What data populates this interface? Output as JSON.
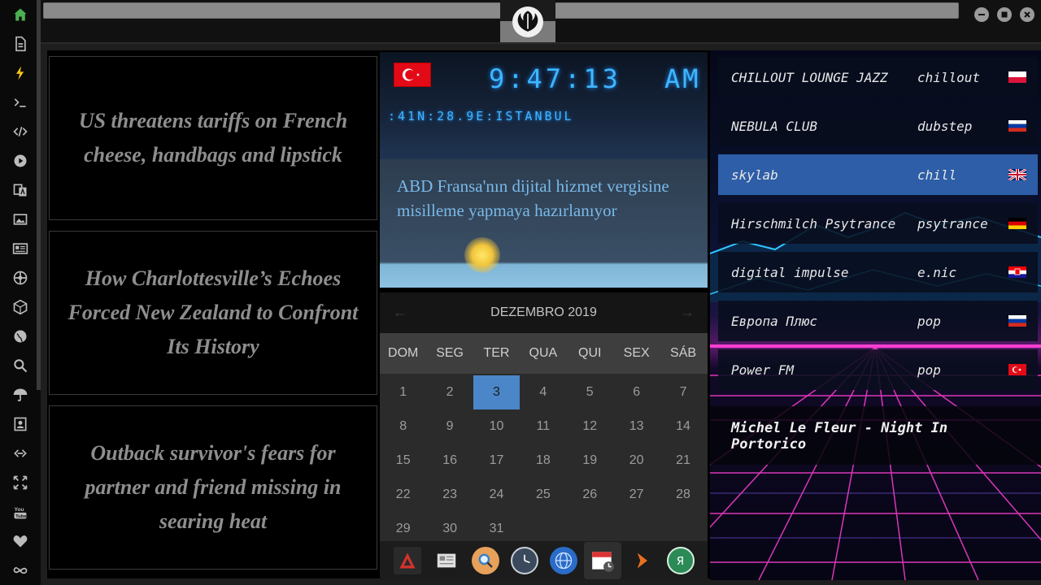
{
  "sidebar": {
    "items": [
      {
        "name": "home-icon"
      },
      {
        "name": "document-icon"
      },
      {
        "name": "lightning-icon"
      },
      {
        "name": "terminal-icon"
      },
      {
        "name": "code-icon"
      },
      {
        "name": "play-icon"
      },
      {
        "name": "translate-icon"
      },
      {
        "name": "image-icon"
      },
      {
        "name": "news-icon"
      },
      {
        "name": "aperture-icon"
      },
      {
        "name": "hexagon-icon"
      },
      {
        "name": "globe-icon"
      },
      {
        "name": "search-icon"
      },
      {
        "name": "umbrella-icon"
      },
      {
        "name": "contacts-icon"
      },
      {
        "name": "link-icon"
      },
      {
        "name": "expand-icon"
      },
      {
        "name": "youtube-icon"
      },
      {
        "name": "heart-icon"
      },
      {
        "name": "infinity-icon"
      }
    ],
    "active_color": "#4caf50"
  },
  "news": [
    "US threatens tariffs on French cheese, handbags and lipstick",
    "How Charlottesville’s Echoes Forced New Zealand to Confront Its History",
    "Outback survivor's fears for partner and friend missing in searing heat"
  ],
  "clock": {
    "time": "9:47:13",
    "ampm": "AM",
    "location": ":41N:28.9E:ISTANBUL",
    "flag": "turkey-flag"
  },
  "translated_news": "ABD Fransa'nın dijital hizmet vergisine misilleme yapmaya hazırlanıyor",
  "calendar": {
    "month": "DEZEMBRO 2019",
    "prev": "←",
    "next": "→",
    "weekdays": [
      "DOM",
      "SEG",
      "TER",
      "QUA",
      "QUI",
      "SEX",
      "SÁB"
    ],
    "weeks": [
      [
        "1",
        "2",
        "3",
        "4",
        "5",
        "6",
        "7"
      ],
      [
        "8",
        "9",
        "10",
        "11",
        "12",
        "13",
        "14"
      ],
      [
        "15",
        "16",
        "17",
        "18",
        "19",
        "20",
        "21"
      ],
      [
        "22",
        "23",
        "24",
        "25",
        "26",
        "27",
        "28"
      ],
      [
        "29",
        "30",
        "31",
        "",
        "",
        "",
        ""
      ]
    ],
    "today": "3"
  },
  "dock": [
    {
      "name": "app-red-icon"
    },
    {
      "name": "news-reader-icon"
    },
    {
      "name": "search-app-icon"
    },
    {
      "name": "clock-app-icon"
    },
    {
      "name": "browser-globe-icon"
    },
    {
      "name": "calendar-app-icon"
    },
    {
      "name": "media-play-icon"
    },
    {
      "name": "yandex-icon"
    }
  ],
  "radio": {
    "stations": [
      {
        "name": "CHILLOUT LOUNGE JAZZ",
        "genre": "chillout",
        "flag": "poland-flag"
      },
      {
        "name": "NEBULA CLUB",
        "genre": "dubstep",
        "flag": "russia-flag"
      },
      {
        "name": "skylab",
        "genre": "chill",
        "flag": "uk-flag"
      },
      {
        "name": "Hirschmilch Psytrance",
        "genre": "psytrance",
        "flag": "germany-flag"
      },
      {
        "name": "digital impulse",
        "genre": "e.nic",
        "flag": "croatia-flag"
      },
      {
        "name": "Европа Плюс",
        "genre": "pop",
        "flag": "russia-flag"
      },
      {
        "name": "Power FM",
        "genre": "pop",
        "flag": "turkey-flag"
      }
    ],
    "selected_index": 2,
    "now_playing": "Michel Le Fleur - Night In Portorico"
  },
  "colors": {
    "accent_blue": "#3fb6ff",
    "selected_station": "#2d5ea7",
    "today_cell": "#4a86c8"
  }
}
